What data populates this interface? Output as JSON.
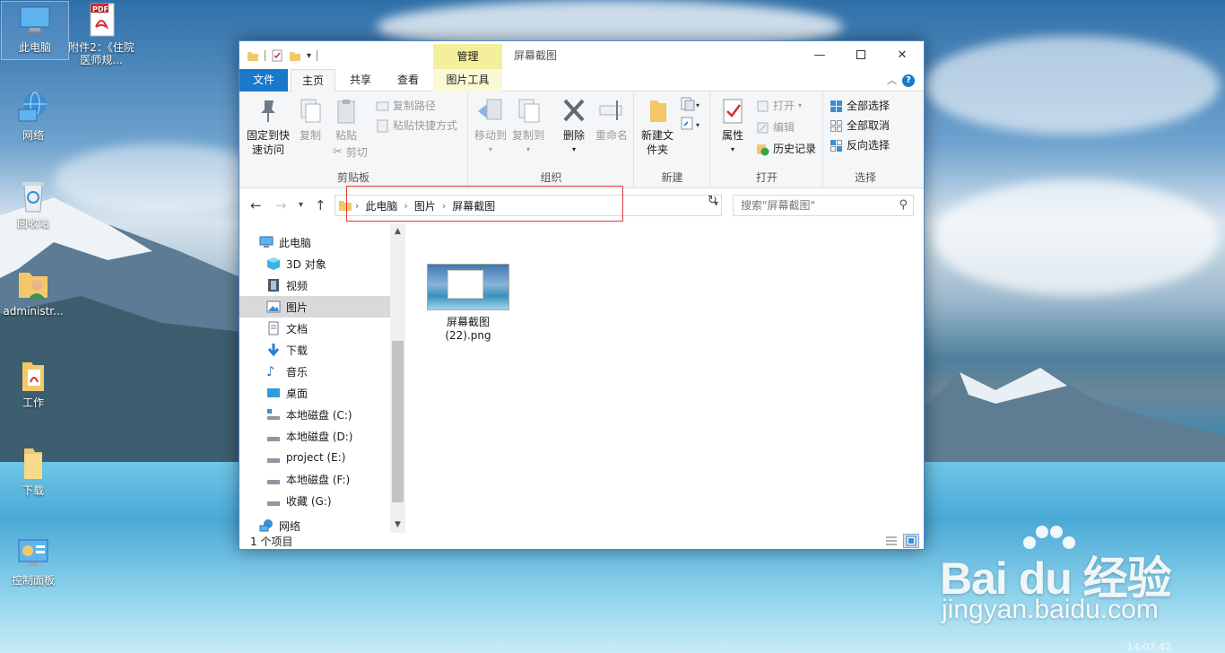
{
  "desktop": {
    "icons": [
      {
        "label": "此电脑"
      },
      {
        "label": "附件2：《住院医师规..."
      },
      {
        "label": "网络"
      },
      {
        "label": "回收站"
      },
      {
        "label": "administr..."
      },
      {
        "label": "工作"
      },
      {
        "label": "下载"
      },
      {
        "label": "控制面板"
      }
    ],
    "pdf_badge": "PDF",
    "clock": "14:07:42"
  },
  "watermark": {
    "logo": "Bai du 经验",
    "url": "jingyan.baidu.com"
  },
  "window": {
    "title": "屏幕截图",
    "context_tab": "管理",
    "tabs": {
      "file": "文件",
      "home": "主页",
      "share": "共享",
      "view": "查看",
      "picture_tools": "图片工具"
    },
    "ribbon": {
      "clipboard": {
        "label": "剪贴板",
        "pin": "固定到快速访问",
        "copy": "复制",
        "paste": "粘贴",
        "copy_path": "复制路径",
        "paste_shortcut": "粘贴快捷方式",
        "cut": "剪切"
      },
      "organize": {
        "label": "组织",
        "move_to": "移动到",
        "copy_to": "复制到",
        "delete": "删除",
        "rename": "重命名"
      },
      "new": {
        "label": "新建",
        "new_folder": "新建文件夹"
      },
      "open": {
        "label": "打开",
        "properties": "属性",
        "open": "打开",
        "edit": "编辑",
        "history": "历史记录"
      },
      "select": {
        "label": "选择",
        "select_all": "全部选择",
        "select_none": "全部取消",
        "invert": "反向选择"
      }
    },
    "address": {
      "crumbs": [
        "此电脑",
        "图片",
        "屏幕截图"
      ]
    },
    "search": {
      "placeholder": "搜索\"屏幕截图\""
    },
    "nav": [
      "此电脑",
      "3D 对象",
      "视频",
      "图片",
      "文档",
      "下载",
      "音乐",
      "桌面",
      "本地磁盘 (C:)",
      "本地磁盘 (D:)",
      "project (E:)",
      "本地磁盘 (F:)",
      "收藏 (G:)",
      "网络"
    ],
    "files": [
      {
        "name_line1": "屏幕截图",
        "name_line2": "(22).png"
      }
    ],
    "status": {
      "count": "1 个项目"
    },
    "colors": {
      "file_tab": "#1979ca",
      "context_tab": "#f4ef9c",
      "highlight": "#e23a3a"
    }
  }
}
